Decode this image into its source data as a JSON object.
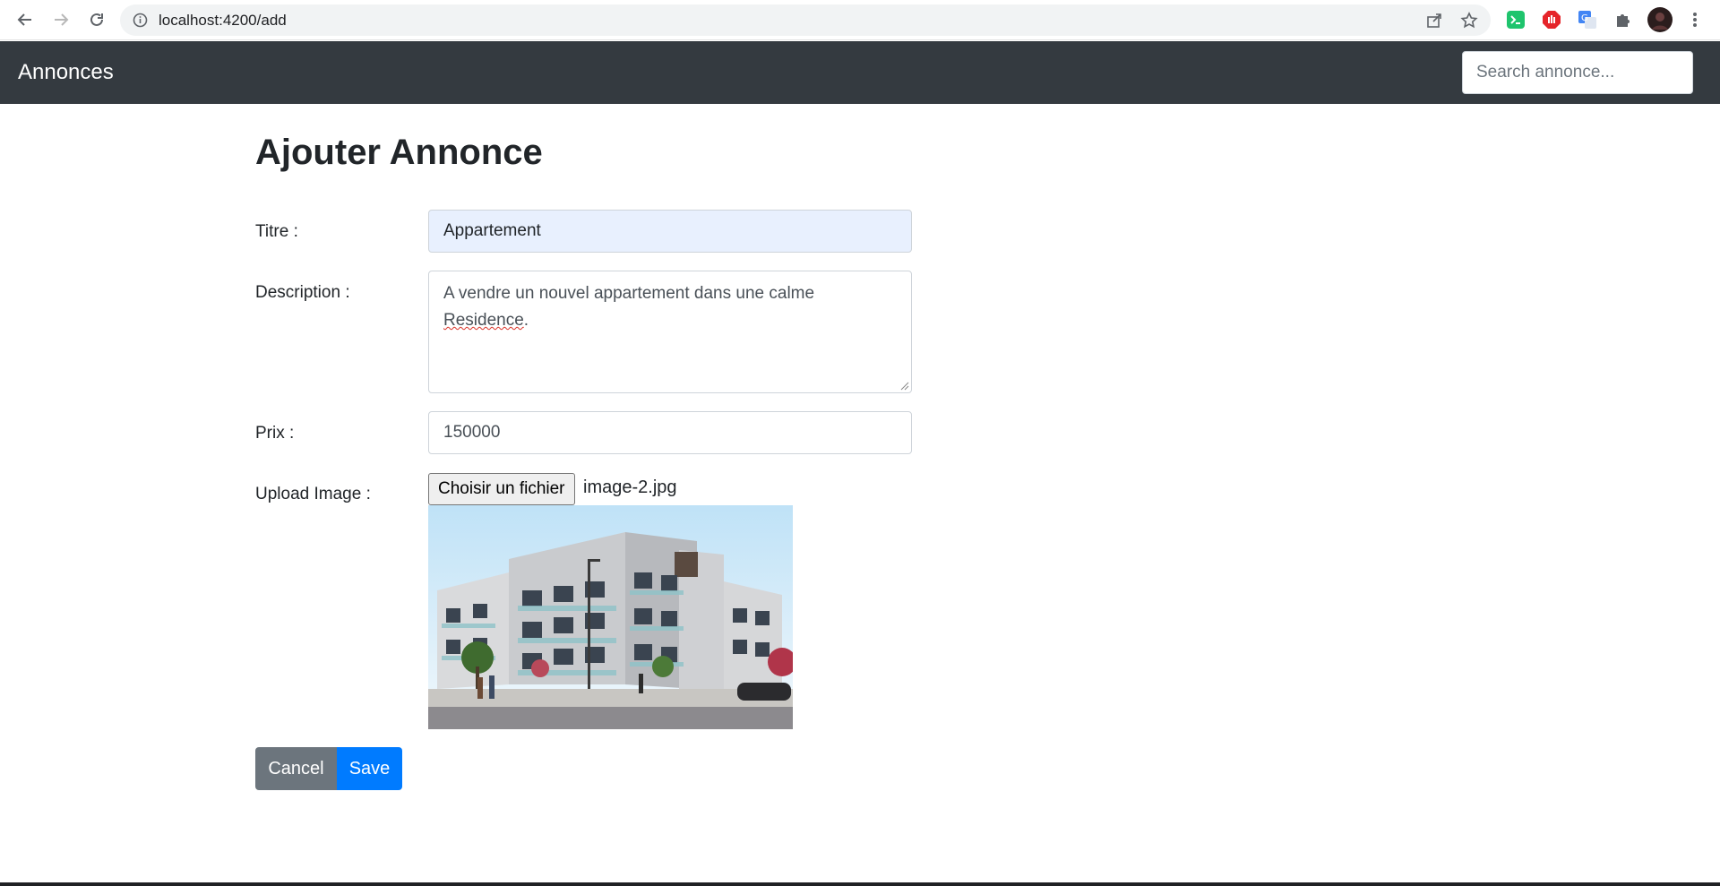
{
  "browser": {
    "url": "localhost:4200/add"
  },
  "navbar": {
    "brand": "Annonces",
    "search_placeholder": "Search annonce..."
  },
  "form": {
    "title": "Ajouter Annonce",
    "titre_label": "Titre :",
    "titre_value": "Appartement",
    "description_label": "Description :",
    "description_text": "A vendre un nouvel appartement dans une calme",
    "description_misspelled": "Residence",
    "description_end": ".",
    "prix_label": "Prix :",
    "prix_value": "150000",
    "upload_label": "Upload Image :",
    "file_button_label": "Choisir un fichier",
    "file_name": "image-2.jpg"
  },
  "actions": {
    "cancel_label": "Cancel",
    "save_label": "Save"
  },
  "colors": {
    "navbar_bg": "#343a40",
    "primary": "#007bff",
    "secondary": "#6c757d",
    "autofill_bg": "#e8f0fe"
  }
}
